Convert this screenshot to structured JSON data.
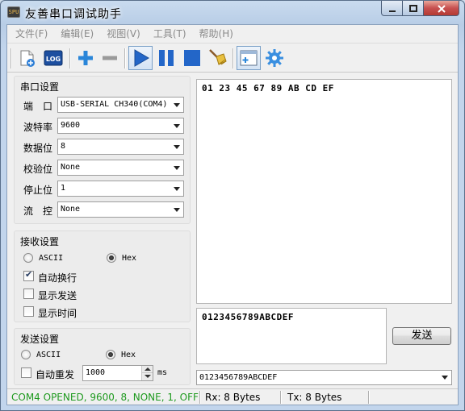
{
  "window": {
    "title": "友善串口调试助手",
    "app_icon_text": "SPU",
    "caption_buttons": [
      "minimize",
      "maximize",
      "close"
    ]
  },
  "menu": [
    "文件(F)",
    "编辑(E)",
    "视图(V)",
    "工具(T)",
    "帮助(H)"
  ],
  "toolbar": {
    "buttons": [
      {
        "name": "new-file-icon"
      },
      {
        "name": "log-icon",
        "label": "LOG"
      },
      {
        "name": "add-icon"
      },
      {
        "name": "remove-icon"
      },
      {
        "name": "play-icon",
        "pressed": true
      },
      {
        "name": "pause-icon"
      },
      {
        "name": "stop-icon"
      },
      {
        "name": "broom-icon"
      },
      {
        "name": "add-window-icon",
        "pressed": true
      },
      {
        "name": "gear-icon"
      }
    ]
  },
  "serial": {
    "header": "串口设置",
    "port_label": "端　口",
    "port_value": "USB-SERIAL CH340(COM4)",
    "baud_label": "波特率",
    "baud_value": "9600",
    "databits_label": "数据位",
    "databits_value": "8",
    "parity_label": "校验位",
    "parity_value": "None",
    "stopbits_label": "停止位",
    "stopbits_value": "1",
    "flow_label": "流　控",
    "flow_value": "None"
  },
  "receive": {
    "header": "接收设置",
    "ascii_label": "ASCII",
    "hex_label": "Hex",
    "selected": "Hex",
    "auto_newline_label": "自动换行",
    "auto_newline_checked": true,
    "show_send_label": "显示发送",
    "show_send_checked": false,
    "show_time_label": "显示时间",
    "show_time_checked": false
  },
  "send": {
    "header": "发送设置",
    "ascii_label": "ASCII",
    "hex_label": "Hex",
    "selected": "Hex",
    "auto_resend_label": "自动重发",
    "auto_resend_checked": false,
    "interval_value": "1000",
    "interval_unit": "ms"
  },
  "receive_area": {
    "text": "01 23 45 67 89 AB CD EF"
  },
  "send_area": {
    "text": "0123456789ABCDEF",
    "send_button": "发送",
    "history_value": "0123456789ABCDEF"
  },
  "status": {
    "port_status": "COM4 OPENED, 9600, 8, NONE, 1, OFF",
    "rx": "Rx: 8 Bytes",
    "tx": "Tx: 8 Bytes",
    "port_status_color": "#1f9a1f"
  }
}
